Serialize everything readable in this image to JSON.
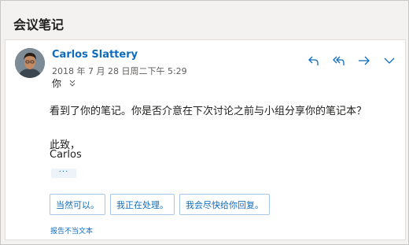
{
  "message": {
    "subject": "会议笔记",
    "sender_name": "Carlos Slattery",
    "datetime": "2018 年 7 月 28 日周二下午 5:29",
    "to_label": "你",
    "body_text": "看到了你的笔记。你是否介意在下次讨论之前与小组分享你的笔记本？",
    "signoff_line1": "此致，",
    "signoff_line2": "Carlos",
    "more_label": "···"
  },
  "actions": {
    "icons": [
      "reply-icon",
      "reply-all-icon",
      "forward-icon",
      "chevron-down-icon"
    ]
  },
  "suggested_replies": [
    "当然可以。",
    "我正在处理。",
    "我会尽快给你回复。"
  ],
  "report_label": "报告不当文本",
  "colors": {
    "accent": "#0f6cbd",
    "background": "#f3f2f1",
    "card": "#ffffff"
  }
}
